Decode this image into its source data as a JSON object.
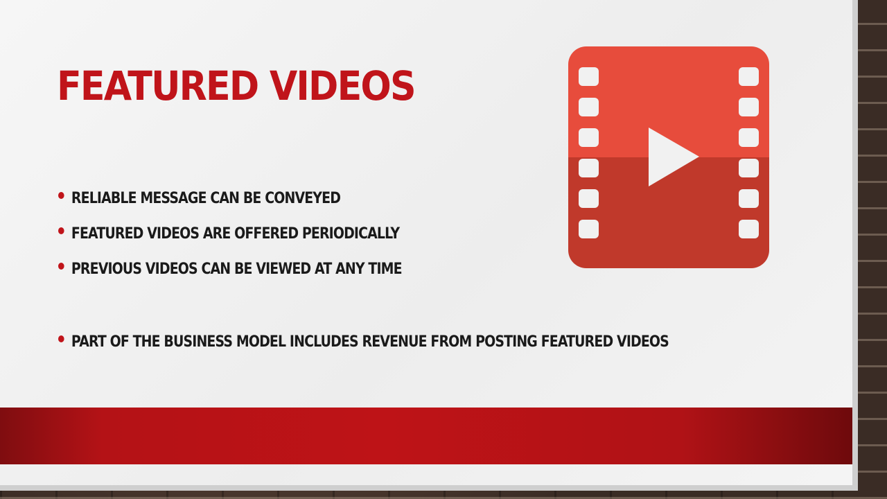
{
  "slide": {
    "title": "Featured Videos",
    "bullets": [
      "Reliable message can be conveyed",
      "Featured videos are offered periodically",
      "Previous videos can be viewed at any time",
      "Part of the business model includes revenue from posting featured videos"
    ]
  },
  "icons": {
    "video": "film-strip-play-icon",
    "bullet": "bullet-dot-icon"
  },
  "colors": {
    "accent_red": "#c0141a",
    "icon_top": "#e74c3c",
    "icon_bottom": "#c0392b",
    "band_dark": "#7f0d10",
    "band_mid": "#be1317",
    "text": "#1a1a1a",
    "background": "#f2f2f2"
  }
}
